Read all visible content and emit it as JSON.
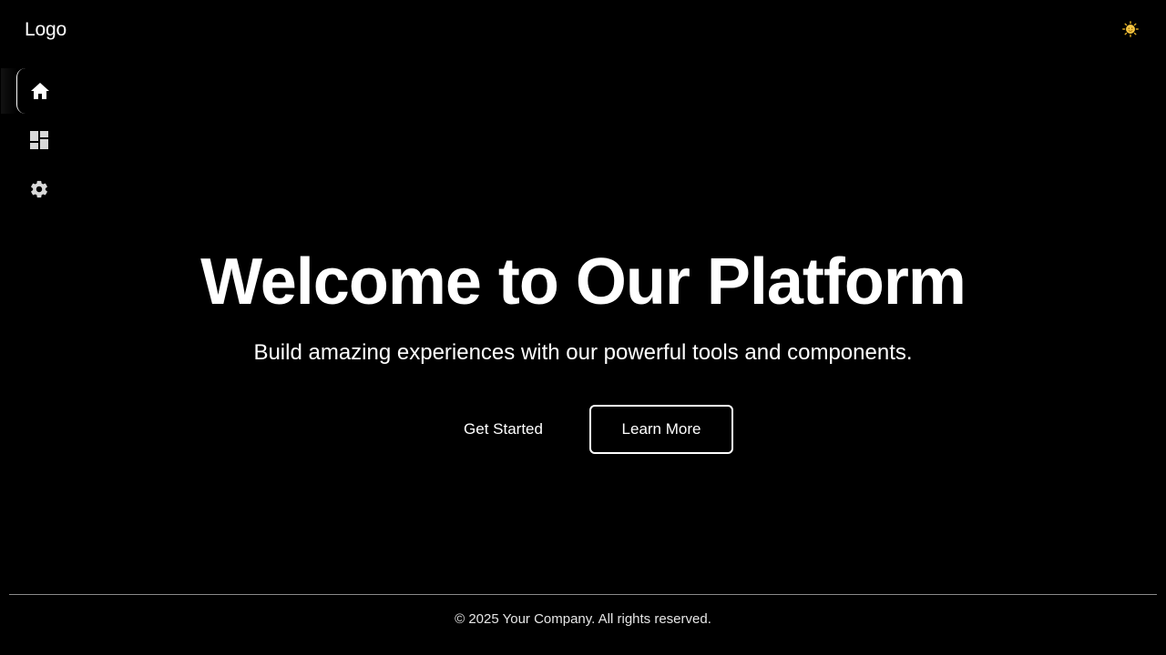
{
  "header": {
    "logo_text": "Logo",
    "theme_toggle_icon": "sun-icon"
  },
  "sidebar": {
    "items": [
      {
        "name": "home",
        "icon": "home-icon",
        "active": true
      },
      {
        "name": "dashboard",
        "icon": "dashboard-icon",
        "active": false
      },
      {
        "name": "settings",
        "icon": "gear-icon",
        "active": false
      }
    ]
  },
  "hero": {
    "title": "Welcome to Our Platform",
    "subtitle": "Build amazing experiences with our powerful tools and components.",
    "primary_button": "Get Started",
    "secondary_button": "Learn More"
  },
  "footer": {
    "copyright": "© 2025 Your Company. All rights reserved."
  },
  "colors": {
    "background": "#000000",
    "text": "#ffffff",
    "divider": "#8a8a8a",
    "sun": "#f5c542"
  }
}
